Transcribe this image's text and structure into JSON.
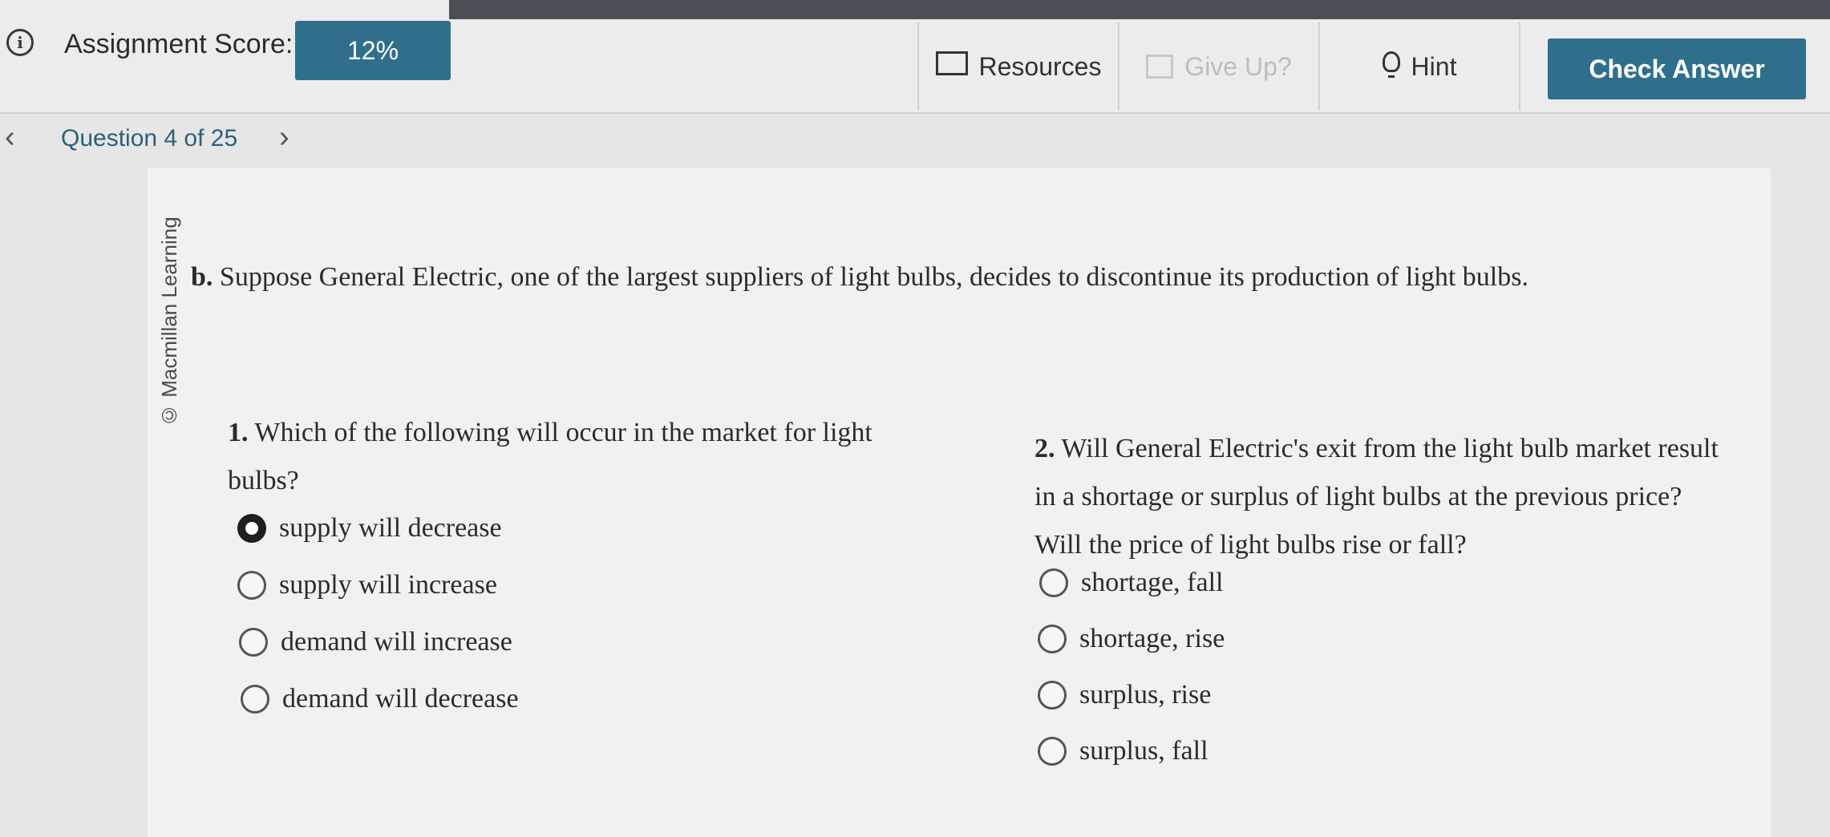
{
  "header": {
    "score_label": "Assignment Score:",
    "score_value": "12%",
    "resources_label": "Resources",
    "giveup_label": "Give Up?",
    "hint_label": "Hint",
    "check_answer_label": "Check Answer"
  },
  "nav": {
    "question_label": "Question 4 of 25"
  },
  "watermark": "© Macmillan Learning",
  "prompt": {
    "letter": "b.",
    "text": "Suppose General Electric, one of the largest suppliers of light bulbs, decides to discontinue its production of light bulbs."
  },
  "question1": {
    "number": "1.",
    "text": "Which of the following will occur in the market for light bulbs?",
    "options": [
      "supply will decrease",
      "supply will increase",
      "demand will increase",
      "demand will decrease"
    ],
    "selected_index": 0
  },
  "question2": {
    "number": "2.",
    "text": "Will General Electric's exit from the light bulb market result in a shortage or surplus of light bulbs at the previous price? Will the price of light bulbs rise or fall?",
    "options": [
      "shortage, fall",
      "shortage, rise",
      "surplus, rise",
      "surplus, fall"
    ],
    "selected_index": null
  },
  "colors": {
    "accent": "#2f6f8c",
    "background": "#e6e6e6",
    "panel": "#f1f1f0"
  },
  "icons": {
    "info": "info-icon",
    "resources": "folder-icon",
    "giveup": "give-up-icon",
    "hint": "lightbulb-icon",
    "prev": "chevron-left-icon",
    "next": "chevron-right-icon"
  }
}
